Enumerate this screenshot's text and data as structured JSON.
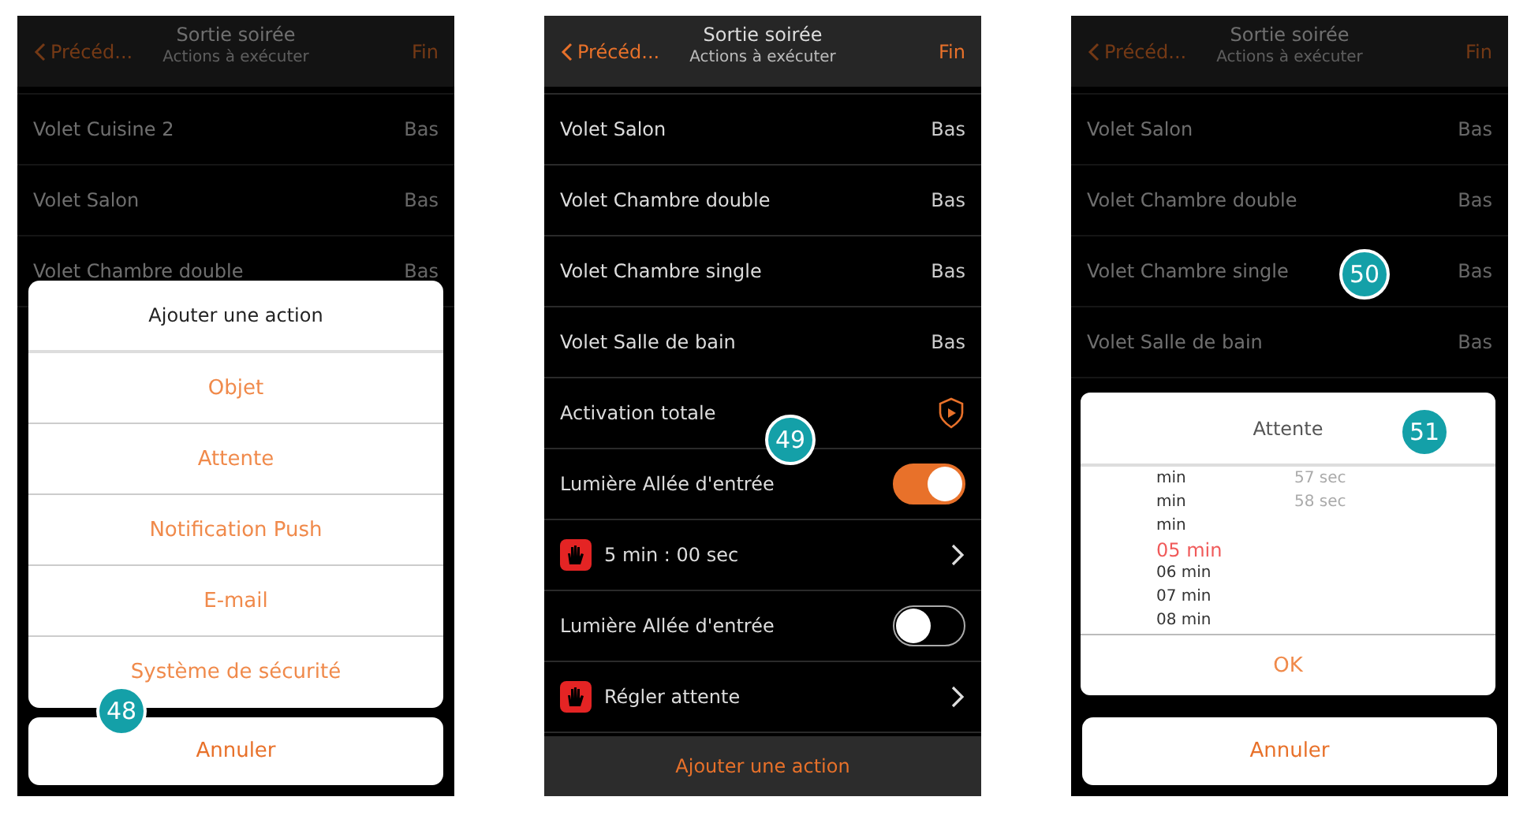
{
  "screens": [
    {
      "header": {
        "back": "Précéd...",
        "title": "Sortie soirée",
        "subtitle": "Actions à exécuter",
        "done": "Fin"
      },
      "dimmed": true,
      "step": "48",
      "rows": [
        {
          "kind": "value",
          "label": "Volet Cuisine 2",
          "value": "Bas"
        },
        {
          "kind": "value",
          "label": "Volet Salon",
          "value": "Bas"
        },
        {
          "kind": "value",
          "label": "Volet Chambre double",
          "value": "Bas"
        }
      ],
      "sheet": {
        "title": "Ajouter une action",
        "options": [
          "Objet",
          "Attente",
          "Notification Push",
          "E-mail",
          "Système de sécurité"
        ],
        "cancel": "Annuler"
      }
    },
    {
      "header": {
        "back": "Précéd...",
        "title": "Sortie soirée",
        "subtitle": "Actions à exécuter",
        "done": "Fin"
      },
      "dimmed": false,
      "step": "49",
      "rows": [
        {
          "kind": "value",
          "label": "Volet Salon",
          "value": "Bas"
        },
        {
          "kind": "value",
          "label": "Volet Chambre double",
          "value": "Bas"
        },
        {
          "kind": "value",
          "label": "Volet Chambre single",
          "value": "Bas"
        },
        {
          "kind": "value",
          "label": "Volet Salle de bain",
          "value": "Bas"
        },
        {
          "kind": "shield",
          "label": "Activation totale"
        },
        {
          "kind": "toggle",
          "label": "Lumière Allée d'entrée",
          "on": true
        },
        {
          "kind": "wait",
          "label": "5 min : 00 sec"
        },
        {
          "kind": "toggle",
          "label": "Lumière Allée d'entrée",
          "on": false
        },
        {
          "kind": "wait",
          "label": "Régler attente"
        }
      ],
      "footer": "Ajouter une action"
    },
    {
      "header": {
        "back": "Précéd...",
        "title": "Sortie soirée",
        "subtitle": "Actions à exécuter",
        "done": "Fin"
      },
      "dimmed": true,
      "step": "50",
      "step2": "51",
      "rows": [
        {
          "kind": "value",
          "label": "Volet Salon",
          "value": "Bas"
        },
        {
          "kind": "value",
          "label": "Volet Chambre double",
          "value": "Bas"
        },
        {
          "kind": "value",
          "label": "Volet Chambre single",
          "value": "Bas"
        },
        {
          "kind": "value",
          "label": "Volet Salle de bain",
          "value": "Bas"
        }
      ],
      "dialog": {
        "title": "Attente",
        "minutes": [
          {
            "label": "min",
            "selected": false
          },
          {
            "label": "min",
            "selected": false
          },
          {
            "label": "min",
            "selected": false
          },
          {
            "label": "05 min",
            "selected": true
          },
          {
            "label": "06 min",
            "selected": false
          },
          {
            "label": "07 min",
            "selected": false
          },
          {
            "label": "08 min",
            "selected": false
          }
        ],
        "seconds": [
          "57 sec",
          "58 sec"
        ],
        "ok": "OK",
        "cancel": "Annuler"
      }
    }
  ]
}
